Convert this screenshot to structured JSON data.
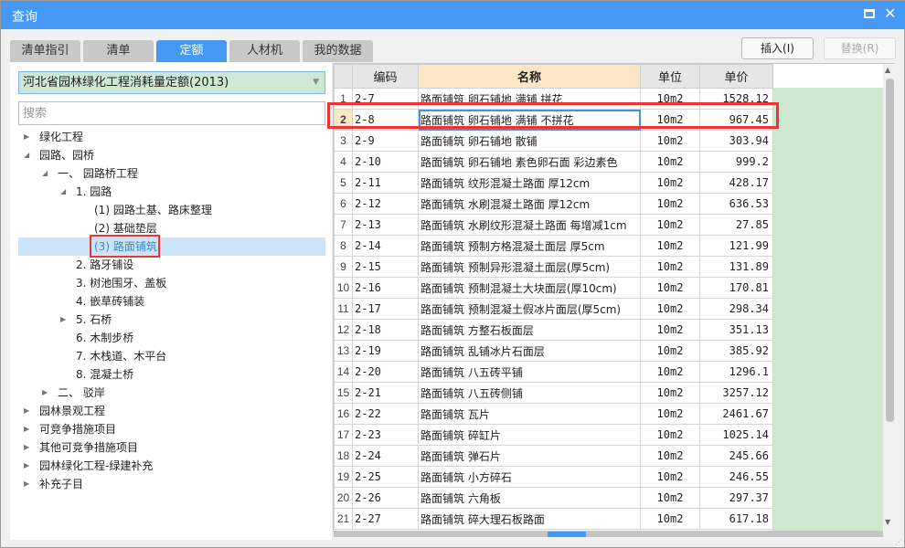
{
  "window": {
    "title": "查询",
    "maximize_icon": "maximize-icon",
    "close_icon": "close-icon"
  },
  "tabs": [
    {
      "label": "清单指引"
    },
    {
      "label": "清单"
    },
    {
      "label": "定额",
      "active": true
    },
    {
      "label": "人材机"
    },
    {
      "label": "我的数据"
    }
  ],
  "buttons": {
    "insert": "插入(I)",
    "replace": "替换(R)"
  },
  "library": {
    "selected": "河北省园林绿化工程消耗量定额(2013)"
  },
  "search": {
    "placeholder": "搜索",
    "value": ""
  },
  "tree": [
    {
      "label": "绿化工程",
      "level": 0,
      "state": "collapsed"
    },
    {
      "label": "园路、园桥",
      "level": 0,
      "state": "expanded"
    },
    {
      "label": "一、 园路桥工程",
      "level": 1,
      "state": "expanded"
    },
    {
      "label": "1. 园路",
      "level": 2,
      "state": "expanded"
    },
    {
      "label": "(1) 园路土基、路床整理",
      "level": 3,
      "state": "leaf"
    },
    {
      "label": "(2) 基础垫层",
      "level": 3,
      "state": "leaf"
    },
    {
      "label": "(3) 路面铺筑",
      "level": 3,
      "state": "leaf",
      "selected": true
    },
    {
      "label": "2. 路牙铺设",
      "level": 2,
      "state": "leaf"
    },
    {
      "label": "3. 树池围牙、盖板",
      "level": 2,
      "state": "leaf"
    },
    {
      "label": "4. 嵌草砖铺装",
      "level": 2,
      "state": "leaf"
    },
    {
      "label": "5. 石桥",
      "level": 2,
      "state": "collapsed"
    },
    {
      "label": "6. 木制步桥",
      "level": 2,
      "state": "leaf"
    },
    {
      "label": "7. 木栈道、木平台",
      "level": 2,
      "state": "leaf"
    },
    {
      "label": "8. 混凝土桥",
      "level": 2,
      "state": "leaf"
    },
    {
      "label": "二、 驳岸",
      "level": 1,
      "state": "collapsed"
    },
    {
      "label": "园林景观工程",
      "level": 0,
      "state": "collapsed"
    },
    {
      "label": "可竞争措施项目",
      "level": 0,
      "state": "collapsed"
    },
    {
      "label": "其他可竞争措施项目",
      "level": 0,
      "state": "collapsed"
    },
    {
      "label": "园林绿化工程-绿建补充",
      "level": 0,
      "state": "collapsed"
    },
    {
      "label": "补充子目",
      "level": 0,
      "state": "collapsed"
    }
  ],
  "table": {
    "columns": [
      "",
      "编码",
      "名称",
      "单位",
      "单价"
    ],
    "current_row": 2,
    "rows": [
      [
        "1",
        "2-7",
        "路面铺筑 卵石铺地 满铺 拼花",
        "10m2",
        "1528.12"
      ],
      [
        "2",
        "2-8",
        "路面铺筑 卵石铺地 满铺 不拼花",
        "10m2",
        "967.45"
      ],
      [
        "3",
        "2-9",
        "路面铺筑 卵石铺地 散铺",
        "10m2",
        "303.94"
      ],
      [
        "4",
        "2-10",
        "路面铺筑 卵石铺地 素色卵石面 彩边素色",
        "10m2",
        "999.2"
      ],
      [
        "5",
        "2-11",
        "路面铺筑 纹形混凝土路面 厚12cm",
        "10m2",
        "428.17"
      ],
      [
        "6",
        "2-12",
        "路面铺筑 水刷混凝土路面 厚12cm",
        "10m2",
        "636.53"
      ],
      [
        "7",
        "2-13",
        "路面铺筑 水刷纹形混凝土路面 每增减1cm",
        "10m2",
        "27.85"
      ],
      [
        "8",
        "2-14",
        "路面铺筑 预制方格混凝土面层 厚5cm",
        "10m2",
        "121.99"
      ],
      [
        "9",
        "2-15",
        "路面铺筑 预制异形混凝土面层(厚5cm)",
        "10m2",
        "131.89"
      ],
      [
        "10",
        "2-16",
        "路面铺筑 预制混凝土大块面层(厚10cm)",
        "10m2",
        "170.81"
      ],
      [
        "11",
        "2-17",
        "路面铺筑 预制混凝土假冰片面层(厚5cm)",
        "10m2",
        "298.34"
      ],
      [
        "12",
        "2-18",
        "路面铺筑 方整石板面层",
        "10m2",
        "351.13"
      ],
      [
        "13",
        "2-19",
        "路面铺筑 乱铺冰片石面层",
        "10m2",
        "385.92"
      ],
      [
        "14",
        "2-20",
        "路面铺筑 八五砖平铺",
        "10m2",
        "1296.1"
      ],
      [
        "15",
        "2-21",
        "路面铺筑 八五砖侧铺",
        "10m2",
        "3257.12"
      ],
      [
        "16",
        "2-22",
        "路面铺筑 瓦片",
        "10m2",
        "2461.67"
      ],
      [
        "17",
        "2-23",
        "路面铺筑 碎缸片",
        "10m2",
        "1025.14"
      ],
      [
        "18",
        "2-24",
        "路面铺筑 弹石片",
        "10m2",
        "245.66"
      ],
      [
        "19",
        "2-25",
        "路面铺筑 小方碎石",
        "10m2",
        "246.55"
      ],
      [
        "20",
        "2-26",
        "路面铺筑 六角板",
        "10m2",
        "297.37"
      ],
      [
        "21",
        "2-27",
        "路面铺筑 碎大理石板路面",
        "10m2",
        "617.18"
      ]
    ]
  },
  "colors": {
    "accent": "#4698f5",
    "highlight": "#ee3333",
    "selected_row": "#cce4f7",
    "name_header": "#fde6c8",
    "green": "#cde8d4"
  }
}
